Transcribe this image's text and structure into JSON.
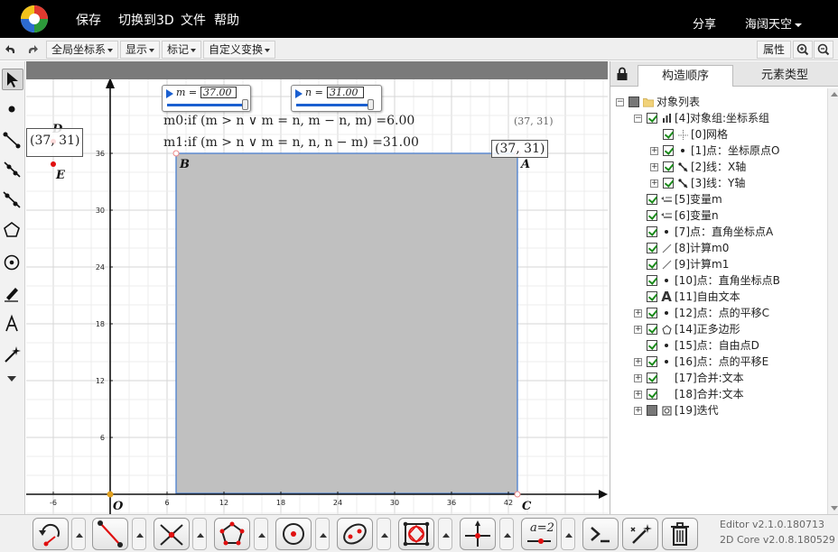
{
  "topbar": {
    "menu": [
      "保存",
      "切换到3D",
      "文件",
      "帮助"
    ],
    "share": "分享",
    "user": "海阔天空"
  },
  "toolbar": {
    "dropdowns": [
      "全局坐标系",
      "显示",
      "标记",
      "自定义变换"
    ],
    "props_label": "属性"
  },
  "canvas": {
    "slider_m": {
      "label": "m =",
      "value": "37.00"
    },
    "slider_n": {
      "label": "n =",
      "value": "31.00"
    },
    "expr_m0": "m0:if (m > n ∨ m = n, m − n, m) =6.00",
    "expr_m1": "m1:if (m > n ∨ m = n, n, n − m) =31.00",
    "coord_small": "(37, 31)",
    "coord_A": "(37, 31)",
    "coord_D": "(37, 31)",
    "points": {
      "A": "A",
      "B": "B",
      "C": "C",
      "D": "D",
      "E": "E",
      "O": "O"
    },
    "x_ticks": [
      "-6",
      "6",
      "12",
      "18",
      "24",
      "30",
      "36",
      "42"
    ],
    "y_ticks": [
      "36",
      "30",
      "24",
      "18",
      "12",
      "6"
    ]
  },
  "panel": {
    "tabs": [
      "构造顺序",
      "元素类型"
    ],
    "tree": [
      {
        "label": "对象列表"
      },
      {
        "label": "[4]对象组:坐标系组"
      },
      {
        "label": "[0]网格"
      },
      {
        "label": "[1]点：坐标原点O"
      },
      {
        "label": "[2]线：X轴"
      },
      {
        "label": "[3]线：Y轴"
      },
      {
        "label": "[5]变量m"
      },
      {
        "label": "[6]变量n"
      },
      {
        "label": "[7]点：直角坐标点A"
      },
      {
        "label": "[8]计算m0"
      },
      {
        "label": "[9]计算m1"
      },
      {
        "label": "[10]点：直角坐标点B"
      },
      {
        "label": "[11]自由文本"
      },
      {
        "label": "[12]点：点的平移C"
      },
      {
        "label": "[14]正多边形"
      },
      {
        "label": "[15]点：自由点D"
      },
      {
        "label": "[16]点：点的平移E"
      },
      {
        "label": "[17]合并:文本"
      },
      {
        "label": "[18]合并:文本"
      },
      {
        "label": "[19]迭代"
      }
    ]
  },
  "bottombar": {
    "text_tool_label": "a=2",
    "version_editor": "Editor v2.1.0.180713",
    "version_core": "2D Core v2.0.8.180529"
  },
  "colors": {
    "square_fill": "#c0c0c0",
    "square_stroke": "#4a7fd0",
    "accent_blue": "#1a5fd0",
    "point_red": "#e01010"
  }
}
